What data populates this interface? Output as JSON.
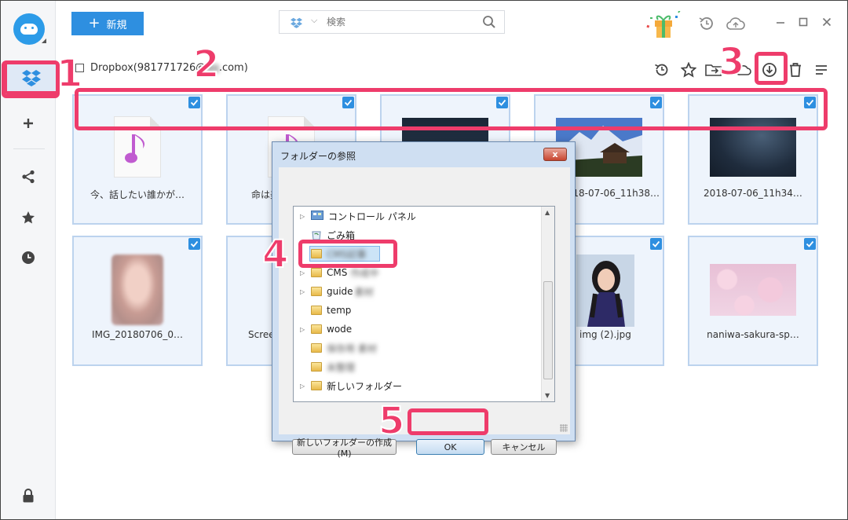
{
  "app": {
    "new_button": "新規",
    "search_placeholder": "検索",
    "account_label": "Dropbox(981771726@",
    "account_label_tail": ".com)"
  },
  "sidebar": {
    "items": [
      {
        "icon": "dropbox-icon",
        "active": true
      },
      {
        "icon": "plus-icon"
      },
      {
        "icon": "share-icon"
      },
      {
        "icon": "star-icon"
      },
      {
        "icon": "clock-icon"
      },
      {
        "icon": "lock-icon"
      }
    ]
  },
  "files": [
    {
      "name": "今、話したい誰かが…",
      "type": "music"
    },
    {
      "name": "命は美…",
      "type": "music"
    },
    {
      "name": "",
      "type": "night"
    },
    {
      "name": "2018-07-06_11h38…",
      "type": "mountain"
    },
    {
      "name": "2018-07-06_11h34…",
      "type": "night"
    },
    {
      "name": "IMG_20180706_0…",
      "type": "face"
    },
    {
      "name": "Scree…",
      "type": "screen"
    },
    {
      "name": "",
      "type": "none"
    },
    {
      "name": "img (2).jpg",
      "type": "girl"
    },
    {
      "name": "naniwa-sakura-sp…",
      "type": "sakura"
    }
  ],
  "dialog": {
    "title": "フォルダーの参照",
    "close": "x",
    "tree": [
      {
        "label": "コントロール パネル",
        "kind": "control"
      },
      {
        "label": "ごみ箱",
        "kind": "trash"
      },
      {
        "label": "CMS記事",
        "kind": "folder",
        "blurred": true,
        "selected": true
      },
      {
        "label": "CMS",
        "kind": "folder",
        "suffix": "作成中"
      },
      {
        "label": "guide",
        "kind": "folder",
        "suffix": "素材"
      },
      {
        "label": "temp",
        "kind": "folder"
      },
      {
        "label": "wode",
        "kind": "folder"
      },
      {
        "label": "保存用 素材",
        "kind": "folder",
        "blurred": true
      },
      {
        "label": "未整理",
        "kind": "folder",
        "blurred": true
      },
      {
        "label": "新しいフォルダー",
        "kind": "folder"
      }
    ],
    "new_folder_button": "新しいフォルダーの作成(M)",
    "ok_button": "OK",
    "cancel_button": "キャンセル"
  },
  "steps": [
    "1",
    "2",
    "3",
    "4",
    "5"
  ],
  "colors": {
    "accent": "#2e8fe0",
    "highlight": "#ee3c6b",
    "music": "#c05bd0"
  }
}
